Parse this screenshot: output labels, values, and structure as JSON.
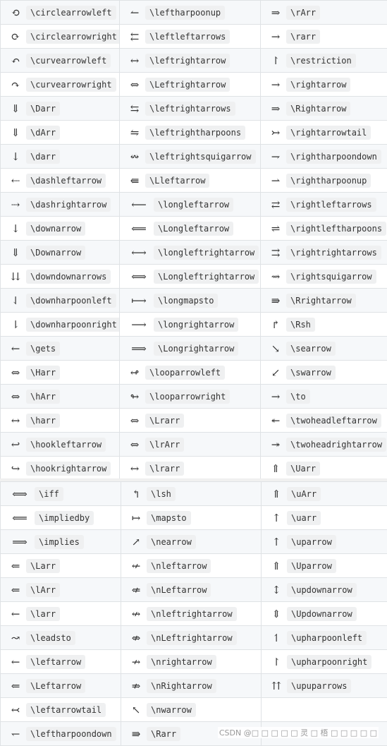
{
  "table1": [
    [
      {
        "sym": "⟲",
        "cmd": "\\circlearrowleft"
      },
      {
        "sym": "↼",
        "cmd": "\\leftharpoonup"
      },
      {
        "sym": "⇒",
        "cmd": "\\rArr"
      }
    ],
    [
      {
        "sym": "⟳",
        "cmd": "\\circlearrowright"
      },
      {
        "sym": "⇇",
        "cmd": "\\leftleftarrows"
      },
      {
        "sym": "→",
        "cmd": "\\rarr"
      }
    ],
    [
      {
        "sym": "↶",
        "cmd": "\\curvearrowleft"
      },
      {
        "sym": "↔",
        "cmd": "\\leftrightarrow"
      },
      {
        "sym": "↾",
        "cmd": "\\restriction"
      }
    ],
    [
      {
        "sym": "↷",
        "cmd": "\\curvearrowright"
      },
      {
        "sym": "⇔",
        "cmd": "\\Leftrightarrow"
      },
      {
        "sym": "→",
        "cmd": "\\rightarrow"
      }
    ],
    [
      {
        "sym": "⇓",
        "cmd": "\\Darr"
      },
      {
        "sym": "⇆",
        "cmd": "\\leftrightarrows"
      },
      {
        "sym": "⇒",
        "cmd": "\\Rightarrow"
      }
    ],
    [
      {
        "sym": "⇓",
        "cmd": "\\dArr"
      },
      {
        "sym": "⇋",
        "cmd": "\\leftrightharpoons"
      },
      {
        "sym": "↣",
        "cmd": "\\rightarrowtail"
      }
    ],
    [
      {
        "sym": "↓",
        "cmd": "\\darr"
      },
      {
        "sym": "↭",
        "cmd": "\\leftrightsquigarrow"
      },
      {
        "sym": "⇁",
        "cmd": "\\rightharpoondown"
      }
    ],
    [
      {
        "sym": "⇠",
        "cmd": "\\dashleftarrow"
      },
      {
        "sym": "⇚",
        "cmd": "\\Lleftarrow"
      },
      {
        "sym": "⇀",
        "cmd": "\\rightharpoonup"
      }
    ],
    [
      {
        "sym": "⇢",
        "cmd": "\\dashrightarrow"
      },
      {
        "sym": "⟵",
        "cmd": "\\longleftarrow"
      },
      {
        "sym": "⇄",
        "cmd": "\\rightleftarrows"
      }
    ],
    [
      {
        "sym": "↓",
        "cmd": "\\downarrow"
      },
      {
        "sym": "⟸",
        "cmd": "\\Longleftarrow"
      },
      {
        "sym": "⇌",
        "cmd": "\\rightleftharpoons"
      }
    ],
    [
      {
        "sym": "⇓",
        "cmd": "\\Downarrow"
      },
      {
        "sym": "⟷",
        "cmd": "\\longleftrightarrow"
      },
      {
        "sym": "⇉",
        "cmd": "\\rightrightarrows"
      }
    ],
    [
      {
        "sym": "⇊",
        "cmd": "\\downdownarrows"
      },
      {
        "sym": "⟺",
        "cmd": "\\Longleftrightarrow"
      },
      {
        "sym": "⇝",
        "cmd": "\\rightsquigarrow"
      }
    ],
    [
      {
        "sym": "⇃",
        "cmd": "\\downharpoonleft"
      },
      {
        "sym": "⟼",
        "cmd": "\\longmapsto"
      },
      {
        "sym": "⇛",
        "cmd": "\\Rrightarrow"
      }
    ],
    [
      {
        "sym": "⇂",
        "cmd": "\\downharpoonright"
      },
      {
        "sym": "⟶",
        "cmd": "\\longrightarrow"
      },
      {
        "sym": "↱",
        "cmd": "\\Rsh"
      }
    ],
    [
      {
        "sym": "←",
        "cmd": "\\gets"
      },
      {
        "sym": "⟹",
        "cmd": "\\Longrightarrow"
      },
      {
        "sym": "↘",
        "cmd": "\\searrow"
      }
    ],
    [
      {
        "sym": "⇔",
        "cmd": "\\Harr"
      },
      {
        "sym": "↫",
        "cmd": "\\looparrowleft"
      },
      {
        "sym": "↙",
        "cmd": "\\swarrow"
      }
    ],
    [
      {
        "sym": "⇔",
        "cmd": "\\hArr"
      },
      {
        "sym": "↬",
        "cmd": "\\looparrowright"
      },
      {
        "sym": "→",
        "cmd": "\\to"
      }
    ],
    [
      {
        "sym": "↔",
        "cmd": "\\harr"
      },
      {
        "sym": "⇔",
        "cmd": "\\Lrarr"
      },
      {
        "sym": "↞",
        "cmd": "\\twoheadleftarrow"
      }
    ],
    [
      {
        "sym": "↩",
        "cmd": "\\hookleftarrow"
      },
      {
        "sym": "⇔",
        "cmd": "\\lrArr"
      },
      {
        "sym": "↠",
        "cmd": "\\twoheadrightarrow"
      }
    ],
    [
      {
        "sym": "↪",
        "cmd": "\\hookrightarrow"
      },
      {
        "sym": "↔",
        "cmd": "\\lrarr"
      },
      {
        "sym": "⇑",
        "cmd": "\\Uarr"
      }
    ]
  ],
  "table2": [
    [
      {
        "sym": "⟺",
        "cmd": "\\iff"
      },
      {
        "sym": "↰",
        "cmd": "\\lsh"
      },
      {
        "sym": "⇑",
        "cmd": "\\uArr"
      }
    ],
    [
      {
        "sym": "⟸",
        "cmd": "\\impliedby"
      },
      {
        "sym": "↦",
        "cmd": "\\mapsto"
      },
      {
        "sym": "↑",
        "cmd": "\\uarr"
      }
    ],
    [
      {
        "sym": "⟹",
        "cmd": "\\implies"
      },
      {
        "sym": "↗",
        "cmd": "\\nearrow"
      },
      {
        "sym": "↑",
        "cmd": "\\uparrow"
      }
    ],
    [
      {
        "sym": "⇐",
        "cmd": "\\Larr"
      },
      {
        "sym": "↚",
        "cmd": "\\nleftarrow"
      },
      {
        "sym": "⇑",
        "cmd": "\\Uparrow"
      }
    ],
    [
      {
        "sym": "⇐",
        "cmd": "\\lArr"
      },
      {
        "sym": "⇍",
        "cmd": "\\nLeftarrow"
      },
      {
        "sym": "↕",
        "cmd": "\\updownarrow"
      }
    ],
    [
      {
        "sym": "←",
        "cmd": "\\larr"
      },
      {
        "sym": "↮",
        "cmd": "\\nleftrightarrow"
      },
      {
        "sym": "⇕",
        "cmd": "\\Updownarrow"
      }
    ],
    [
      {
        "sym": "↝",
        "cmd": "\\leadsto"
      },
      {
        "sym": "⇎",
        "cmd": "\\nLeftrightarrow"
      },
      {
        "sym": "↿",
        "cmd": "\\upharpoonleft"
      }
    ],
    [
      {
        "sym": "←",
        "cmd": "\\leftarrow"
      },
      {
        "sym": "↛",
        "cmd": "\\nrightarrow"
      },
      {
        "sym": "↾",
        "cmd": "\\upharpoonright"
      }
    ],
    [
      {
        "sym": "⇐",
        "cmd": "\\Leftarrow"
      },
      {
        "sym": "⇏",
        "cmd": "\\nRightarrow"
      },
      {
        "sym": "⇈",
        "cmd": "\\upuparrows"
      }
    ],
    [
      {
        "sym": "↢",
        "cmd": "\\leftarrowtail"
      },
      {
        "sym": "↖",
        "cmd": "\\nwarrow"
      },
      null
    ],
    [
      {
        "sym": "↽",
        "cmd": "\\leftharpoondown"
      },
      {
        "sym": "⇛",
        "cmd": "\\Rarr"
      },
      null
    ]
  ],
  "watermark": "CSDN @□ □ □ □ □ 灵 □ 梧 □ □ □ □ □"
}
